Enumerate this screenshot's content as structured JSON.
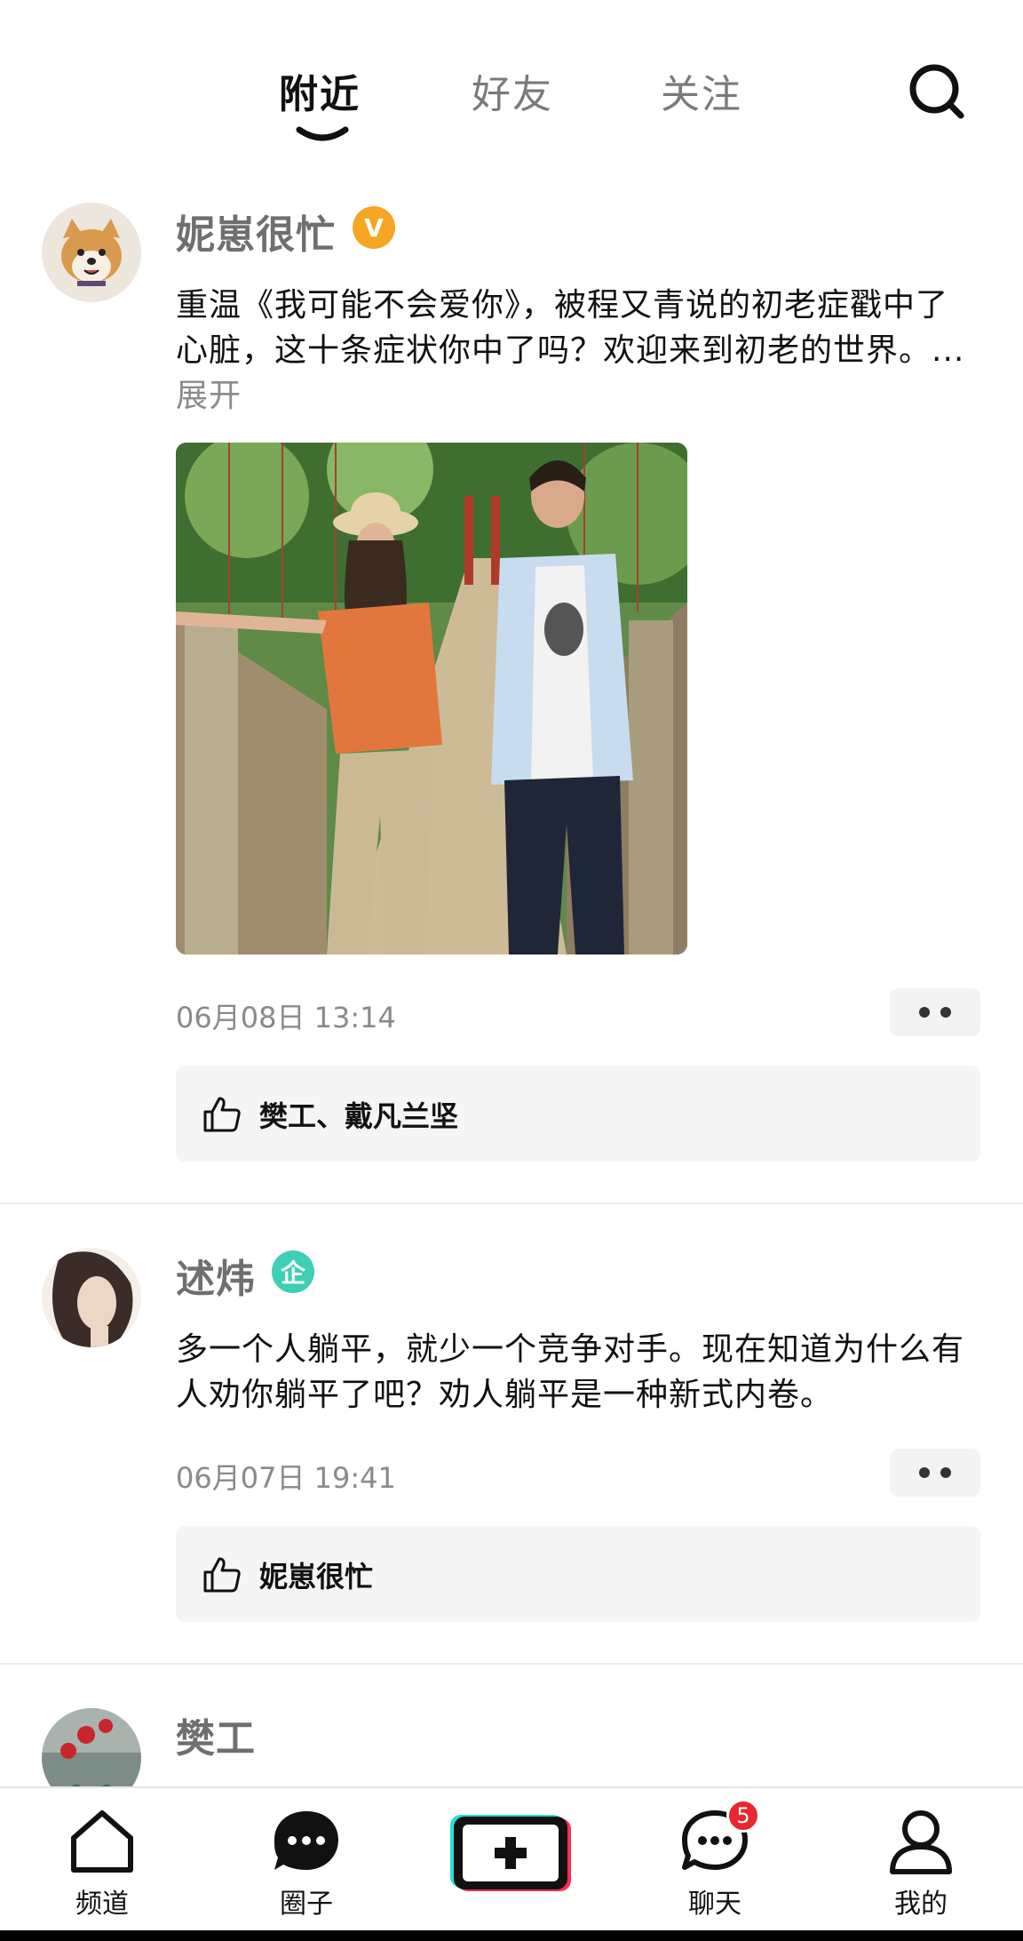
{
  "tabs": [
    {
      "label": "附近",
      "active": true
    },
    {
      "label": "好友",
      "active": false
    },
    {
      "label": "关注",
      "active": false
    }
  ],
  "posts": [
    {
      "username": "妮崽很忙",
      "badge": "V",
      "badge_color": "#f6a623",
      "text": "重温《我可能不会爱你》，被程又青说的初老症戳中了心脏，这十条症状你中了吗？欢迎来到初老的世界。...",
      "expand_label": "展开",
      "time": "06月08日 13:14",
      "likes": "樊工、戴凡兰坚"
    },
    {
      "username": "述炜",
      "badge": "企",
      "badge_color": "#3ecfb4",
      "text": "多一个人躺平，就少一个竞争对手。现在知道为什么有人劝你躺平了吧？劝人躺平是一种新式内卷。",
      "time": "06月07日 19:41",
      "likes": "妮崽很忙"
    },
    {
      "username": "樊工"
    }
  ],
  "bottom_nav": [
    {
      "label": "频道",
      "icon": "home-icon"
    },
    {
      "label": "圈子",
      "icon": "circle-chat-icon"
    },
    {
      "label": "",
      "icon": "add-post-icon"
    },
    {
      "label": "聊天",
      "icon": "chat-icon",
      "badge": "5"
    },
    {
      "label": "我的",
      "icon": "profile-icon"
    }
  ],
  "colors": {
    "active_tab": "#111111",
    "inactive_tab": "#7a7a7a",
    "notification_badge": "#e8272e"
  }
}
